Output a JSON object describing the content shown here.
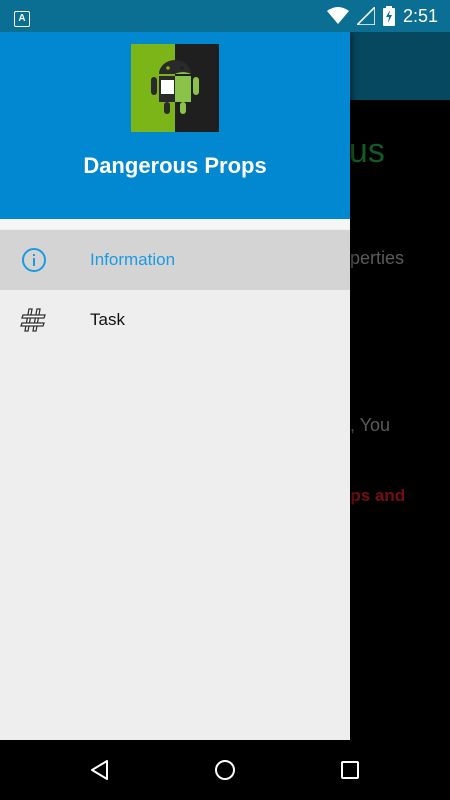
{
  "status_bar": {
    "time": "2:51",
    "notification_icon_letter": "A",
    "icons": [
      "notification-a-icon",
      "wifi-icon",
      "signal-icon",
      "battery-charging-icon"
    ]
  },
  "background": {
    "title_fragment": "ous",
    "line1_fragment": "operties",
    "line2_fragment": "e, You",
    "line3_fragment": "ops and"
  },
  "drawer": {
    "header": {
      "title": "Dangerous Props",
      "logo_badge": "#5"
    },
    "items": [
      {
        "label": "Information",
        "icon": "info-icon",
        "active": true
      },
      {
        "label": "Task",
        "icon": "hash-icon",
        "active": false
      }
    ]
  },
  "colors": {
    "header": "#0288d1",
    "status_bar": "#0a6f93",
    "active_item_text": "#1a9be3",
    "background_title": "#1e8a3a",
    "background_warning": "#b3161b"
  },
  "nav_bar": {
    "buttons": [
      "back-icon",
      "home-icon",
      "recents-icon"
    ]
  }
}
